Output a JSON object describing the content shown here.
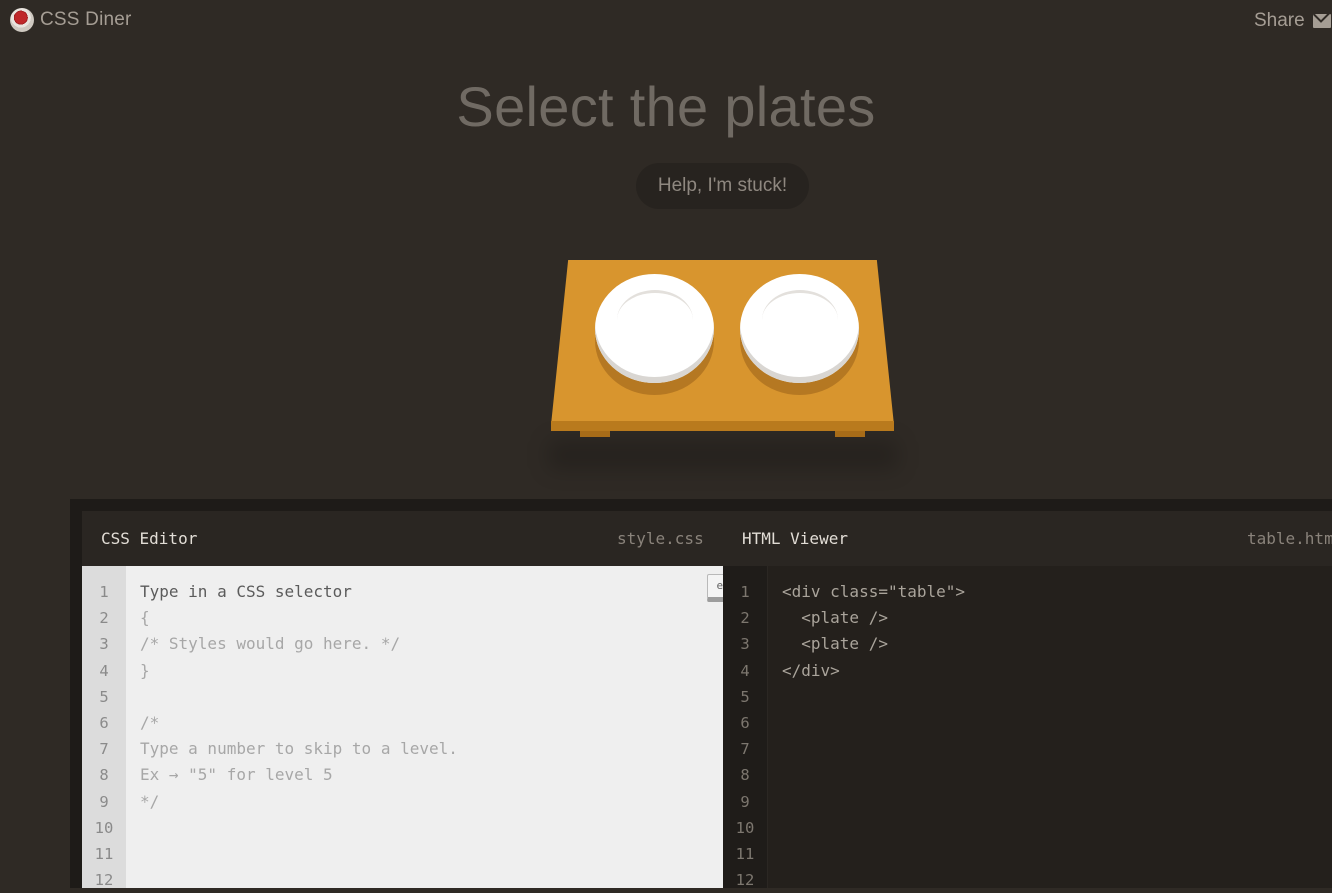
{
  "topbar": {
    "brand": "CSS Diner",
    "share_label": "Share"
  },
  "level": {
    "instruction": "Select the plates",
    "help_label": "Help, I'm stuck!"
  },
  "css_editor": {
    "title": "CSS Editor",
    "filename": "style.css",
    "placeholder": "Type in a CSS selector",
    "enter_label": "enter",
    "lines": [
      "{",
      "/* Styles would go here. */",
      "}",
      "",
      "/*",
      "Type a number to skip to a level.",
      "Ex → \"5\" for level 5",
      "*/"
    ],
    "line_numbers": [
      "1",
      "2",
      "3",
      "4",
      "5",
      "6",
      "7",
      "8",
      "9",
      "10",
      "11",
      "12"
    ]
  },
  "html_viewer": {
    "title": "HTML Viewer",
    "filename": "table.html",
    "lines": [
      "<div class=\"table\">",
      "  <plate />",
      "  <plate />",
      "</div>"
    ],
    "line_numbers": [
      "1",
      "2",
      "3",
      "4",
      "5",
      "6",
      "7",
      "8",
      "9",
      "10",
      "11",
      "12"
    ]
  },
  "colors": {
    "background": "#2f2a25",
    "table": "#d8952e",
    "plate": "#ffffff",
    "brand_dot": "#c0282a"
  }
}
